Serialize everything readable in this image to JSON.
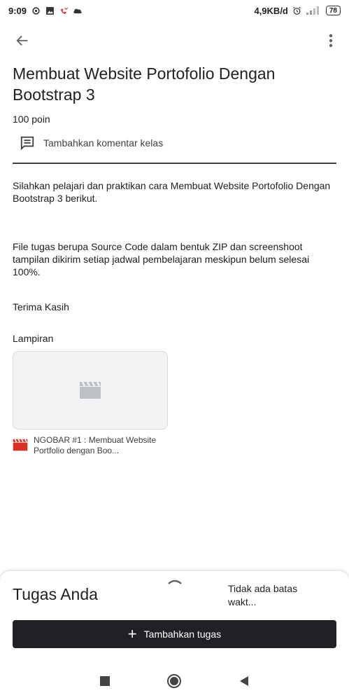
{
  "status_bar": {
    "time": "9:09",
    "network_speed": "4,9KB/d",
    "battery": "78",
    "icons": [
      "sync-icon",
      "gallery-icon",
      "missed-call-icon",
      "cloud-icon",
      "alarm-icon",
      "signal-icon",
      "battery-icon"
    ]
  },
  "app_bar": {
    "back_icon": "arrow-back-icon",
    "more_icon": "more-vert-icon"
  },
  "assignment": {
    "title": "Membuat Website Portofolio Dengan Bootstrap 3",
    "points": "100 poin",
    "comment_label": "Tambahkan komentar kelas",
    "description": [
      "Silahkan pelajari dan praktikan cara Membuat Website Portofolio Dengan Bootstrap 3 berikut.",
      "File tugas berupa Source Code dalam bentuk ZIP dan screenshoot tampilan dikirim setiap jadwal pembelajaran meskipun belum selesai 100%.",
      "Terima Kasih"
    ]
  },
  "attachments": {
    "heading": "Lampiran",
    "items": [
      {
        "name": "NGOBAR #1 : Membuat Website Portfolio dengan Boo...",
        "icon": "video-icon",
        "color": "#d93025"
      }
    ]
  },
  "your_work": {
    "heading": "Tugas Anda",
    "due": "Tidak ada batas wakt...",
    "add_button": "Tambahkan tugas"
  },
  "colors": {
    "button_bg": "#202124",
    "thumbnail_icon": "#bdc1c6",
    "video_red": "#d93025"
  }
}
